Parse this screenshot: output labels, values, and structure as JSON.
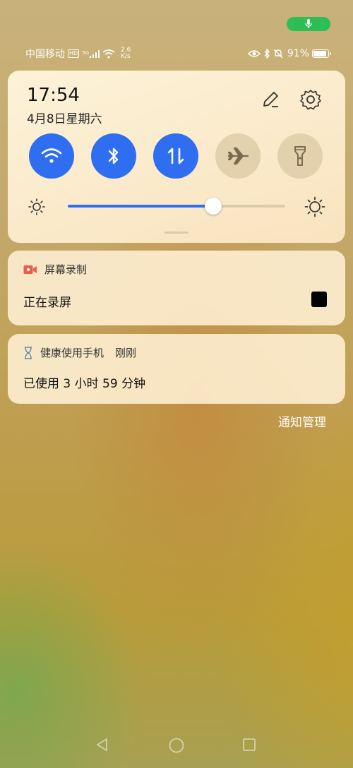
{
  "status_bar": {
    "carrier": "中国移动",
    "hd": "HD",
    "network": "5G",
    "speed_value": "2.6",
    "speed_unit": "K/s",
    "battery_percent": "91%",
    "battery_level": 0.91
  },
  "quick_settings": {
    "time": "17:54",
    "date": "4月8日星期六",
    "tiles": [
      {
        "name": "wifi",
        "on": true
      },
      {
        "name": "bluetooth",
        "on": true
      },
      {
        "name": "mobile-data",
        "on": true
      },
      {
        "name": "airplane-mode",
        "on": false
      },
      {
        "name": "flashlight",
        "on": false
      }
    ],
    "brightness_level": 0.67
  },
  "notifications": [
    {
      "app": "屏幕录制",
      "text": "正在录屏"
    },
    {
      "app": "健康使用手机",
      "time": "刚刚",
      "text": "已使用 3 小时 59 分钟"
    }
  ],
  "notification_manage_label": "通知管理",
  "colors": {
    "accent": "#2f6ef0",
    "mic_indicator": "#2dbe55",
    "record_icon": "#e8604c"
  }
}
